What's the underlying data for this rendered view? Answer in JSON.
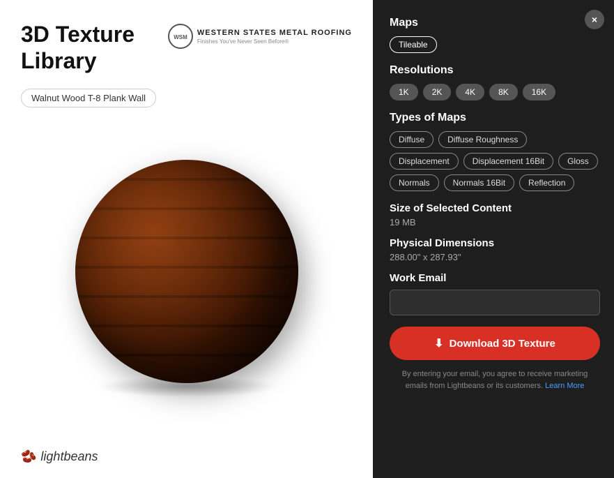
{
  "left": {
    "app_title": "3D Texture\nLibrary",
    "breadcrumb": "Walnut Wood T-8 Plank Wall",
    "brand_name": "WESTERN STATES METAL ROOFING",
    "brand_tagline": "Finishes You've Never Seen Before®",
    "lightbeans_label": "lightbeans"
  },
  "right": {
    "close_label": "×",
    "maps_section": {
      "title": "Maps",
      "tags": [
        {
          "label": "Tileable",
          "active": true
        }
      ]
    },
    "resolutions_section": {
      "title": "Resolutions",
      "tags": [
        {
          "label": "1K",
          "active": false
        },
        {
          "label": "2K",
          "active": false
        },
        {
          "label": "4K",
          "active": false
        },
        {
          "label": "8K",
          "active": false
        },
        {
          "label": "16K",
          "active": false
        }
      ]
    },
    "types_section": {
      "title": "Types of Maps",
      "tags": [
        {
          "label": "Diffuse"
        },
        {
          "label": "Diffuse Roughness"
        },
        {
          "label": "Displacement"
        },
        {
          "label": "Displacement 16Bit"
        },
        {
          "label": "Gloss"
        },
        {
          "label": "Normals"
        },
        {
          "label": "Normals 16Bit"
        },
        {
          "label": "Reflection"
        }
      ]
    },
    "size_section": {
      "title": "Size of Selected Content",
      "value": "19 MB"
    },
    "dimensions_section": {
      "title": "Physical Dimensions",
      "value": "288.00\" x 287.93\""
    },
    "email_section": {
      "title": "Work Email",
      "placeholder": ""
    },
    "download_btn": "Download 3D Texture",
    "consent_text": "By entering your email, you agree to receive marketing\nemails from Lightbeans or its customers.",
    "learn_more": "Learn More"
  }
}
